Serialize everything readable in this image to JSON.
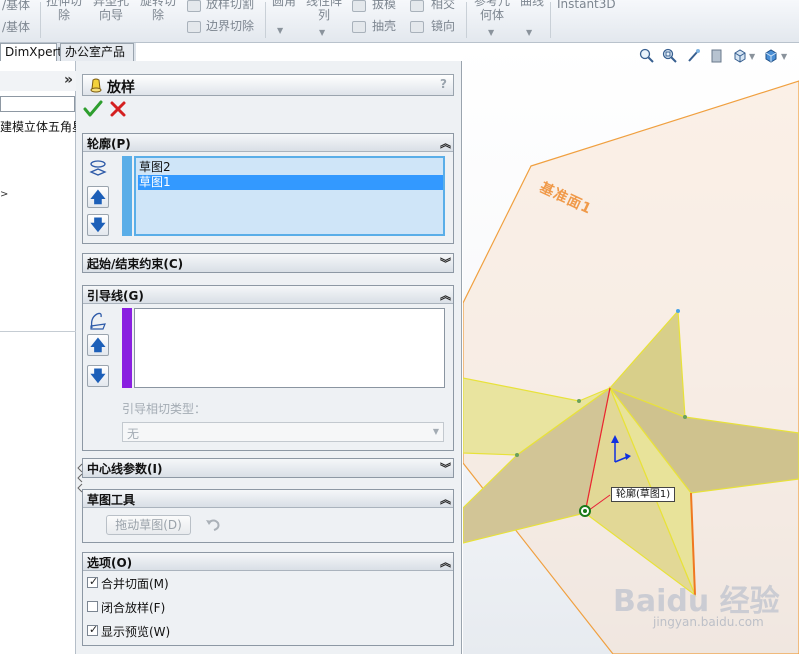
{
  "ribbon": {
    "items": [
      {
        "label": "/基体"
      },
      {
        "label": "/基体"
      },
      {
        "label": "拉伸切\n除"
      },
      {
        "label": "异型孔\n向导"
      },
      {
        "label": "旋转切\n除"
      },
      {
        "label": "放样切割"
      },
      {
        "label": "边界切除"
      },
      {
        "label": "圆角"
      },
      {
        "label": "线性阵\n列"
      },
      {
        "label": "拔模"
      },
      {
        "label": "抽壳"
      },
      {
        "label": "相交"
      },
      {
        "label": "镜向"
      },
      {
        "label": "参考几\n何体"
      },
      {
        "label": "曲线"
      },
      {
        "label": "Instant3D"
      }
    ]
  },
  "tree_tabs": {
    "dimxpert": "DimXpert",
    "office": "办公室产品"
  },
  "tree": {
    "collapse_label": "»",
    "item_label": "建模立体五角星"
  },
  "property_manager": {
    "title": "放样",
    "help": "?",
    "groups": {
      "profiles": {
        "title": "轮廓(P)",
        "items": [
          "草图2",
          "草图1"
        ],
        "selected_index": 1
      },
      "start_end": {
        "title": "起始/结束约束(C)"
      },
      "guides": {
        "title": "引导线(G)",
        "tangency_label": "引导相切类型：",
        "tangency_value": "无"
      },
      "centerline": {
        "title": "中心线参数(I)"
      },
      "sketch_tools": {
        "title": "草图工具",
        "drag_sketch": "拖动草图(D)"
      },
      "options": {
        "title": "选项(O)",
        "checkboxes": [
          {
            "label": "合并切面(M)",
            "checked": true
          },
          {
            "label": "闭合放样(F)",
            "checked": false
          },
          {
            "label": "显示预览(W)",
            "checked": true
          }
        ]
      }
    }
  },
  "viewport": {
    "plane_label": "基准面1",
    "callout": "轮廓(草图1)",
    "watermark_logo": "Baidu 经验",
    "watermark_url": "jingyan.baidu.com"
  },
  "colors": {
    "accent": "#3399ff",
    "guide_swatch": "#8a1fe0",
    "profile_swatch": "#5aaee8",
    "plane_edge": "#f0a040",
    "star_fill": "#e8e39a",
    "ok": "#2e9e2e",
    "cancel": "#d42020"
  }
}
